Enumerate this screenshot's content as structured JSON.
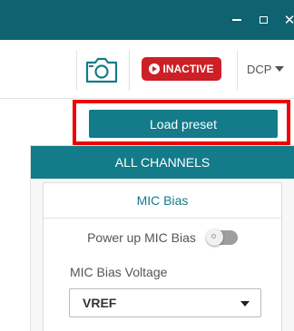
{
  "window": {
    "controls": [
      "minimize",
      "maximize",
      "close"
    ],
    "titlebar_color": "#0f6270"
  },
  "toolbar": {
    "camera_icon": "camera-icon",
    "status_label": "INACTIVE",
    "status_color": "#cc1f26",
    "status_icon": "play-icon",
    "dcp_label": "DCP"
  },
  "actions": {
    "load_preset_label": "Load preset",
    "highlight_color": "#ee0000"
  },
  "panel": {
    "header": "ALL CHANNELS",
    "accent_color": "#137b89",
    "section": {
      "title": "MIC Bias",
      "power_up_label": "Power up MIC Bias",
      "power_up_enabled": false,
      "voltage_label": "MIC Bias Voltage",
      "voltage_value": "VREF"
    }
  }
}
